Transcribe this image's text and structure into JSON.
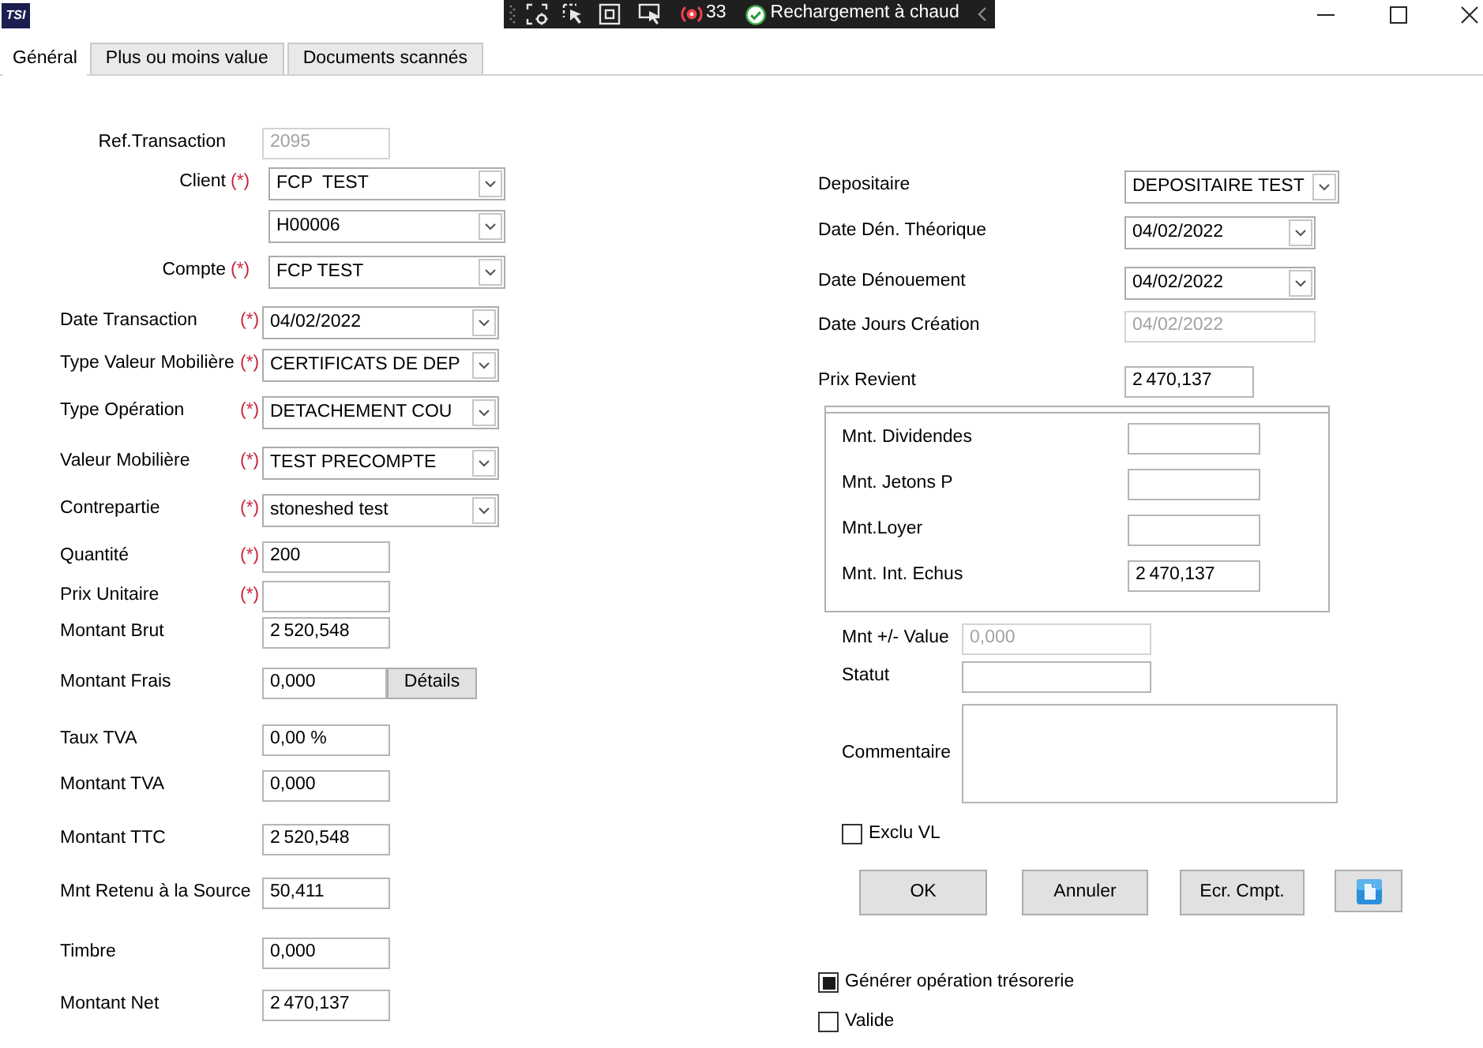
{
  "window": {
    "logo_text": "TSI"
  },
  "debug_toolbar": {
    "issue_count": "33",
    "hot_reload_label": "Rechargement à chaud"
  },
  "tabs": [
    {
      "label": "Général",
      "selected": true
    },
    {
      "label": "Plus ou moins value",
      "selected": false
    },
    {
      "label": "Documents scannés",
      "selected": false
    }
  ],
  "required_marker": "(*)",
  "account_fields": [
    {
      "label": "Ref.Transaction",
      "kind": "text",
      "value": "2095",
      "required": false,
      "disabled": true
    },
    {
      "label": "Client",
      "kind": "combo",
      "value": "FCP  TEST",
      "required": true,
      "disabled": false
    },
    {
      "kind": "combo",
      "value": "H00006",
      "required": false,
      "disabled": false
    },
    {
      "label": "Compte",
      "kind": "combo",
      "value": "FCP TEST",
      "required": true,
      "disabled": false
    }
  ],
  "transaction_fields": [
    {
      "label": "Date Transaction",
      "kind": "combo",
      "value": "04/02/2022",
      "required": true,
      "disabled": false
    },
    {
      "label": "Type Valeur Mobilière",
      "kind": "combo",
      "value": "CERTIFICATS DE DEP",
      "required": true,
      "disabled": false
    },
    {
      "label": "Type Opération",
      "kind": "combo",
      "value": "DETACHEMENT COU",
      "required": true,
      "disabled": false
    },
    {
      "label": "Valeur Mobilière",
      "kind": "combo",
      "value": "TEST PRECOMPTE",
      "required": true,
      "disabled": false
    },
    {
      "label": "Contrepartie",
      "kind": "combo",
      "value": "stoneshed test",
      "required": true,
      "disabled": false
    },
    {
      "label": "Quantité",
      "kind": "text",
      "value": "200",
      "required": true,
      "disabled": false
    },
    {
      "label": "Prix Unitaire",
      "kind": "text",
      "required": true,
      "disabled": false
    },
    {
      "label": "Montant Brut",
      "kind": "text",
      "value": "2 520,548",
      "required": false,
      "disabled": false
    },
    {
      "label": "Montant Frais",
      "kind": "text_button",
      "value": "0,000",
      "button_label": "Détails",
      "required": false,
      "disabled": false
    },
    {
      "label": "Taux TVA",
      "kind": "text",
      "value": "0,00 %",
      "required": false,
      "disabled": false
    },
    {
      "label": "Montant TVA",
      "kind": "text",
      "value": "0,000",
      "required": false,
      "disabled": false
    },
    {
      "label": "Montant TTC",
      "kind": "text",
      "value": "2 520,548",
      "required": false,
      "disabled": false
    },
    {
      "label": "Mnt Retenu à la Source",
      "kind": "text",
      "value": "50,411",
      "required": false,
      "disabled": false
    },
    {
      "label": "Timbre",
      "kind": "text",
      "value": "0,000",
      "required": false,
      "disabled": false
    },
    {
      "label": "Montant Net",
      "kind": "text",
      "value": "2 470,137",
      "required": false,
      "disabled": false
    }
  ],
  "settlement_fields": [
    {
      "label": "Depositaire",
      "kind": "combo",
      "value": "DEPOSITAIRE TEST",
      "disabled": false
    },
    {
      "label": "Date Dén. Théorique",
      "kind": "combo",
      "value": "04/02/2022",
      "disabled": false
    },
    {
      "label": "Date Dénouement",
      "kind": "combo",
      "value": "04/02/2022",
      "disabled": false
    },
    {
      "label": "Date Jours Création",
      "kind": "text",
      "value": "04/02/2022",
      "disabled": true
    },
    {
      "label": "Prix Revient",
      "kind": "text",
      "value": "2 470,137",
      "disabled": false
    }
  ],
  "income_group": [
    {
      "label": "Mnt. Dividendes",
      "kind": "text",
      "disabled": false
    },
    {
      "label": "Mnt. Jetons P",
      "kind": "text",
      "disabled": false
    },
    {
      "label": "Mnt.Loyer",
      "kind": "text",
      "disabled": false
    },
    {
      "label": "Mnt. Int. Echus",
      "kind": "text",
      "value": "2 470,137",
      "disabled": false
    }
  ],
  "status_fields": [
    {
      "label": "Mnt +/- Value",
      "kind": "text",
      "value": "0,000",
      "disabled": true
    },
    {
      "label": "Statut",
      "kind": "text",
      "disabled": false
    },
    {
      "label": "Commentaire",
      "kind": "textarea",
      "disabled": false
    }
  ],
  "exclude_checkbox": {
    "label": "Exclu VL",
    "checked": false
  },
  "buttons": [
    {
      "kind": "text",
      "label": "OK"
    },
    {
      "kind": "text",
      "label": "Annuler"
    },
    {
      "kind": "text",
      "label": "Ecr. Cmpt."
    },
    {
      "kind": "icon"
    }
  ],
  "footer_checkboxes": [
    {
      "label": "Générer opération trésorerie",
      "checked": true
    },
    {
      "label": "Valide",
      "checked": false
    }
  ]
}
